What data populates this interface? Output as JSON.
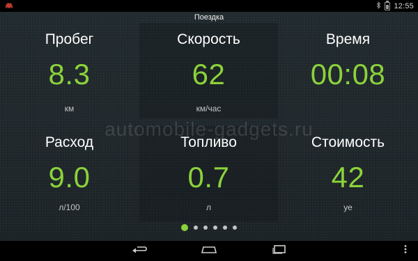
{
  "status": {
    "time": "12:55"
  },
  "title": "Поездка",
  "tiles": [
    {
      "label": "Пробег",
      "value": "8.3",
      "unit": "км"
    },
    {
      "label": "Скорость",
      "value": "62",
      "unit": "км/час"
    },
    {
      "label": "Время",
      "value": "00:08",
      "unit": ""
    },
    {
      "label": "Расход",
      "value": "9.0",
      "unit": "л/100"
    },
    {
      "label": "Топливо",
      "value": "0.7",
      "unit": "л"
    },
    {
      "label": "Стоимость",
      "value": "42",
      "unit": "уе"
    }
  ],
  "watermark": "automobile-gadgets.ru",
  "pager": {
    "pages": 6,
    "current": 1
  },
  "colors": {
    "accent": "#8bd23b",
    "background": "#1f272b"
  },
  "icons": {
    "status_app": "car-app-icon",
    "bluetooth": "bluetooth-icon",
    "battery": "battery-icon",
    "back": "back-icon",
    "home": "home-icon",
    "recents": "recents-icon",
    "menu": "overflow-menu-icon"
  }
}
